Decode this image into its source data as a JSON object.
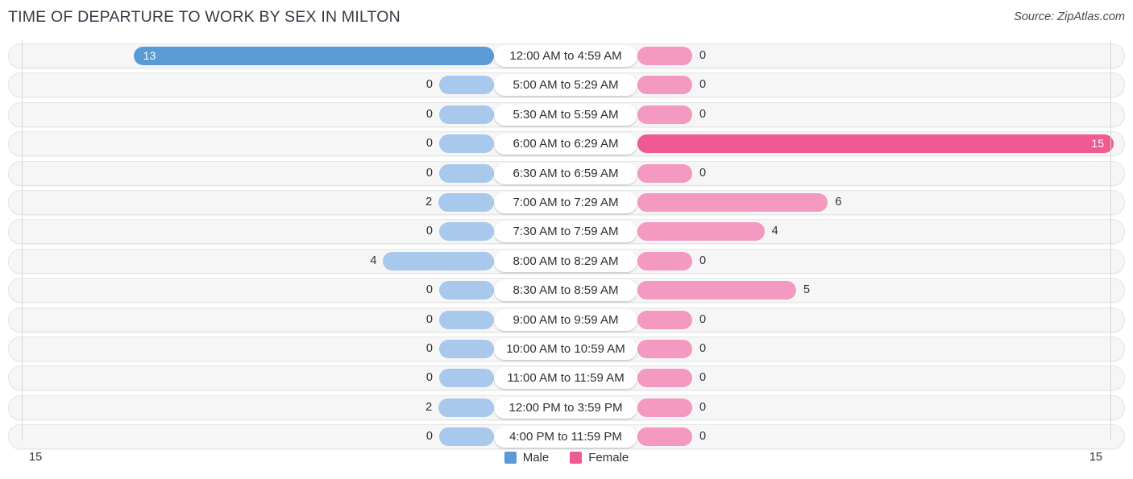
{
  "header": {
    "title": "TIME OF DEPARTURE TO WORK BY SEX IN MILTON",
    "source": "Source: ZipAtlas.com"
  },
  "axis": {
    "left_max_label": "15",
    "right_max_label": "15"
  },
  "legend": {
    "items": [
      {
        "label": "Male",
        "color": "#5b9bd5",
        "swatch": "male"
      },
      {
        "label": "Female",
        "color": "#ef5a92",
        "swatch": "female"
      }
    ]
  },
  "chart_data": {
    "type": "bar",
    "title": "TIME OF DEPARTURE TO WORK BY SEX IN MILTON",
    "subtitle": "",
    "xlabel": "",
    "ylabel": "",
    "orientation": "horizontal-diverging",
    "grid": true,
    "legend_position": "bottom-center",
    "xlim": [
      15,
      15
    ],
    "axis_max": 15,
    "categories": [
      "12:00 AM to 4:59 AM",
      "5:00 AM to 5:29 AM",
      "5:30 AM to 5:59 AM",
      "6:00 AM to 6:29 AM",
      "6:30 AM to 6:59 AM",
      "7:00 AM to 7:29 AM",
      "7:30 AM to 7:59 AM",
      "8:00 AM to 8:29 AM",
      "8:30 AM to 8:59 AM",
      "9:00 AM to 9:59 AM",
      "10:00 AM to 10:59 AM",
      "11:00 AM to 11:59 AM",
      "12:00 PM to 3:59 PM",
      "4:00 PM to 11:59 PM"
    ],
    "series": [
      {
        "name": "Male",
        "color": "#5b9bd5",
        "muted_color": "#a8c9ec",
        "values": [
          13,
          0,
          0,
          0,
          0,
          2,
          0,
          4,
          0,
          0,
          0,
          0,
          2,
          0
        ]
      },
      {
        "name": "Female",
        "color": "#ef5a92",
        "muted_color": "#f49ac1",
        "values": [
          0,
          0,
          0,
          15,
          0,
          6,
          4,
          0,
          5,
          0,
          0,
          0,
          0,
          0
        ]
      }
    ]
  }
}
